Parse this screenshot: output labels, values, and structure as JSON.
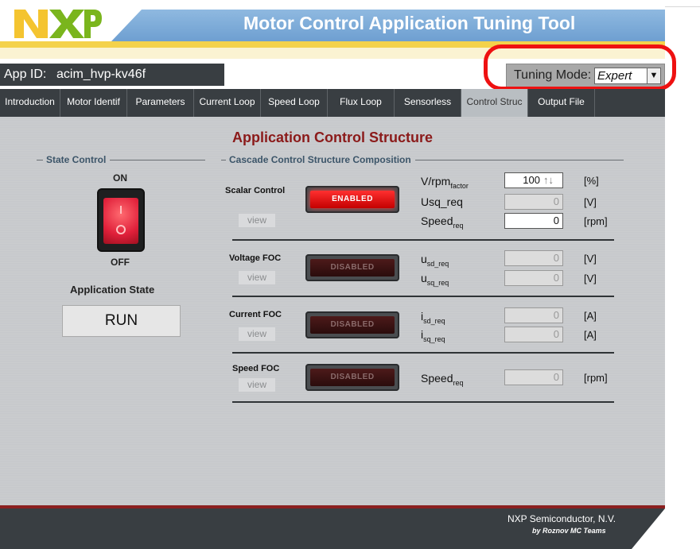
{
  "header": {
    "title": "Motor Control Application Tuning Tool",
    "logo_text": "NXP"
  },
  "app_id": {
    "label": "App ID:",
    "value": "acim_hvp-kv46f"
  },
  "tuning_mode": {
    "label": "Tuning Mode:",
    "value": "Expert"
  },
  "tabs": [
    {
      "label": "Introduction"
    },
    {
      "label": "Motor Identif"
    },
    {
      "label": "Parameters"
    },
    {
      "label": "Current Loop"
    },
    {
      "label": "Speed Loop"
    },
    {
      "label": "Flux Loop"
    },
    {
      "label": "Sensorless"
    },
    {
      "label": "Control Struc"
    },
    {
      "label": "Output File"
    }
  ],
  "main": {
    "title": "Application Control Structure",
    "state_control": {
      "heading": "State Control",
      "on_label": "ON",
      "off_label": "OFF",
      "app_state_label": "Application State",
      "app_state_value": "RUN"
    },
    "cascade": {
      "heading": "Cascade Control Structure Composition",
      "view_label": "view",
      "rows": [
        {
          "name": "Scalar Control",
          "status": "ENABLED",
          "params": [
            {
              "name": "V/rpm",
              "sub": "factor",
              "value": "100",
              "unit": "[%]"
            },
            {
              "name": "Usq_req",
              "sub": "",
              "value": "0",
              "unit": "[V]"
            },
            {
              "name": "Speed",
              "sub": "req",
              "value": "0",
              "unit": "[rpm]"
            }
          ]
        },
        {
          "name": "Voltage FOC",
          "status": "DISABLED",
          "params": [
            {
              "name": "u",
              "sub": "sd_req",
              "value": "0",
              "unit": "[V]"
            },
            {
              "name": "u",
              "sub": "sq_req",
              "value": "0",
              "unit": "[V]"
            }
          ]
        },
        {
          "name": "Current FOC",
          "status": "DISABLED",
          "params": [
            {
              "name": "i",
              "sub": "sd_req",
              "value": "0",
              "unit": "[A]"
            },
            {
              "name": "i",
              "sub": "sq_req",
              "value": "0",
              "unit": "[A]"
            }
          ]
        },
        {
          "name": "Speed FOC",
          "status": "DISABLED",
          "params": [
            {
              "name": "Speed",
              "sub": "req",
              "value": "0",
              "unit": "[rpm]"
            }
          ]
        }
      ]
    }
  },
  "footer": {
    "company": "NXP Semiconductor, N.V.",
    "team": "by Roznov MC Teams"
  },
  "colors": {
    "accent_red": "#8b1a1a",
    "header_blue": "#7aa8d8",
    "header_yellow": "#f4d24b",
    "bar_dark": "#393e42",
    "annotation": "#ee1111"
  }
}
